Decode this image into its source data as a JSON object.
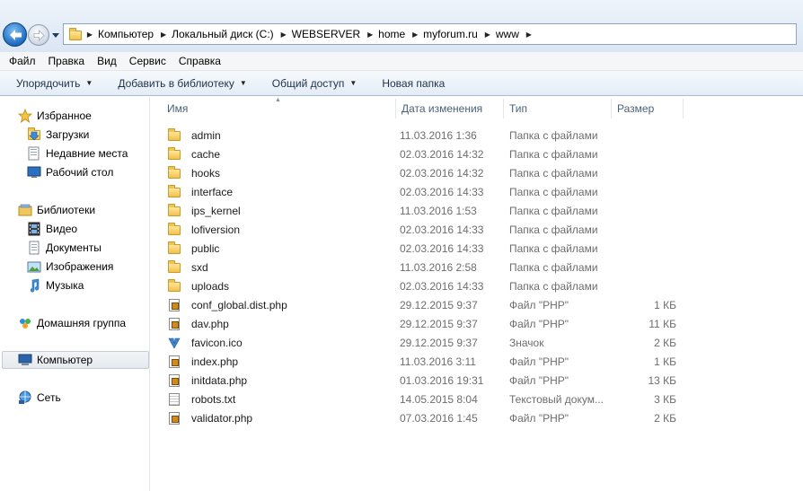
{
  "breadcrumb": [
    "Компьютер",
    "Локальный диск (C:)",
    "WEBSERVER",
    "home",
    "myforum.ru",
    "www"
  ],
  "menu": [
    "Файл",
    "Правка",
    "Вид",
    "Сервис",
    "Справка"
  ],
  "toolbar": {
    "organize": "Упорядочить",
    "add_to_library": "Добавить в библиотеку",
    "share": "Общий доступ",
    "new_folder": "Новая папка"
  },
  "nav": {
    "favorites": "Избранное",
    "downloads": "Загрузки",
    "recent": "Недавние места",
    "desktop": "Рабочий стол",
    "libraries": "Библиотеки",
    "video": "Видео",
    "documents": "Документы",
    "pictures": "Изображения",
    "music": "Музыка",
    "homegroup": "Домашняя группа",
    "computer": "Компьютер",
    "network": "Сеть"
  },
  "columns": {
    "name": "Имя",
    "date": "Дата изменения",
    "type": "Тип",
    "size": "Размер"
  },
  "files": [
    {
      "name": "admin",
      "date": "11.03.2016 1:36",
      "type": "Папка с файлами",
      "size": "",
      "icon": "folder-icon"
    },
    {
      "name": "cache",
      "date": "02.03.2016 14:32",
      "type": "Папка с файлами",
      "size": "",
      "icon": "folder-icon"
    },
    {
      "name": "hooks",
      "date": "02.03.2016 14:32",
      "type": "Папка с файлами",
      "size": "",
      "icon": "folder-icon"
    },
    {
      "name": "interface",
      "date": "02.03.2016 14:33",
      "type": "Папка с файлами",
      "size": "",
      "icon": "folder-icon"
    },
    {
      "name": "ips_kernel",
      "date": "11.03.2016 1:53",
      "type": "Папка с файлами",
      "size": "",
      "icon": "folder-icon"
    },
    {
      "name": "lofiversion",
      "date": "02.03.2016 14:33",
      "type": "Папка с файлами",
      "size": "",
      "icon": "folder-icon"
    },
    {
      "name": "public",
      "date": "02.03.2016 14:33",
      "type": "Папка с файлами",
      "size": "",
      "icon": "folder-icon"
    },
    {
      "name": "sxd",
      "date": "11.03.2016 2:58",
      "type": "Папка с файлами",
      "size": "",
      "icon": "folder-icon"
    },
    {
      "name": "uploads",
      "date": "02.03.2016 14:33",
      "type": "Папка с файлами",
      "size": "",
      "icon": "folder-icon"
    },
    {
      "name": "conf_global.dist.php",
      "date": "29.12.2015 9:37",
      "type": "Файл \"PHP\"",
      "size": "1 КБ",
      "icon": "php-file-icon"
    },
    {
      "name": "dav.php",
      "date": "29.12.2015 9:37",
      "type": "Файл \"PHP\"",
      "size": "11 КБ",
      "icon": "php-file-icon"
    },
    {
      "name": "favicon.ico",
      "date": "29.12.2015 9:37",
      "type": "Значок",
      "size": "2 КБ",
      "icon": "favicon-icon"
    },
    {
      "name": "index.php",
      "date": "11.03.2016 3:11",
      "type": "Файл \"PHP\"",
      "size": "1 КБ",
      "icon": "php-file-icon"
    },
    {
      "name": "initdata.php",
      "date": "01.03.2016 19:31",
      "type": "Файл \"PHP\"",
      "size": "13 КБ",
      "icon": "php-file-icon"
    },
    {
      "name": "robots.txt",
      "date": "14.05.2015 8:04",
      "type": "Текстовый докум...",
      "size": "3 КБ",
      "icon": "text-file-icon"
    },
    {
      "name": "validator.php",
      "date": "07.03.2016 1:45",
      "type": "Файл \"PHP\"",
      "size": "2 КБ",
      "icon": "php-file-icon"
    }
  ]
}
